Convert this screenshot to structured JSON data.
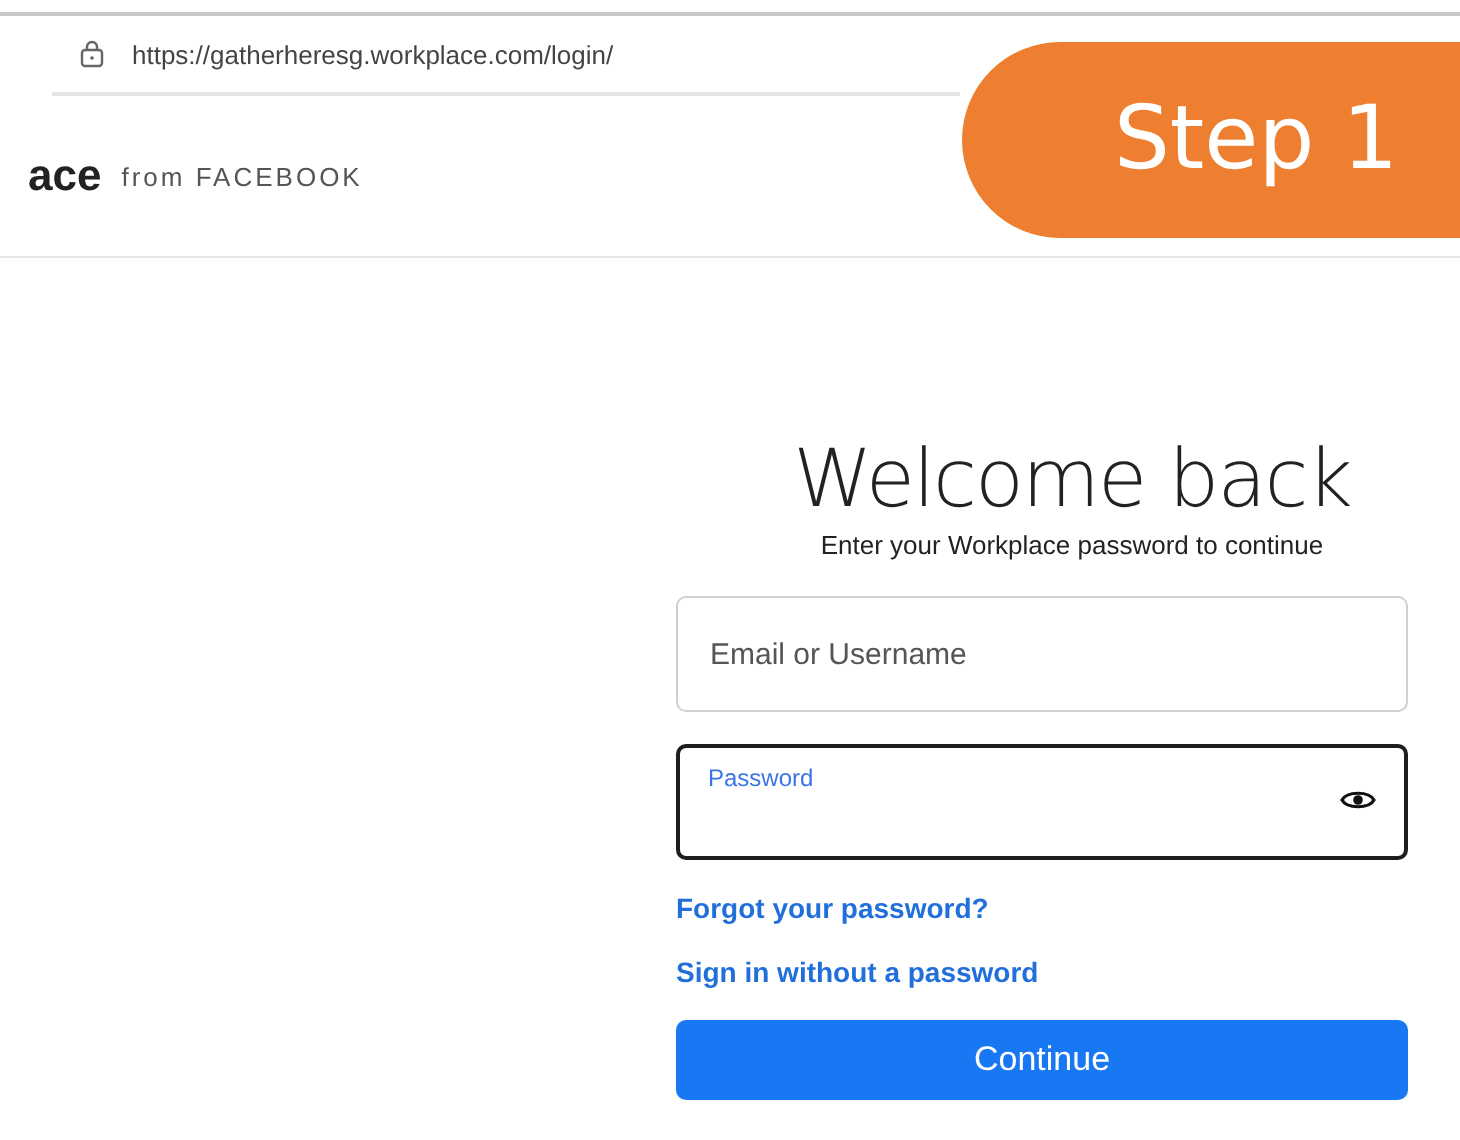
{
  "address_bar": {
    "url": "https://gatherheresg.workplace.com/login/"
  },
  "header": {
    "logo": "ace",
    "tagline": "from FACEBOOK"
  },
  "step_badge": {
    "text": "Step 1"
  },
  "login": {
    "title": "Welcome back",
    "subtitle": "Enter your Workplace password to continue",
    "fields": [
      {
        "kind": "text",
        "placeholder": "Email or Username",
        "focused": false
      },
      {
        "kind": "password",
        "label": "Password",
        "focused": true
      }
    ],
    "links": [
      "Forgot your password?",
      "Sign in without a password"
    ],
    "button": "Continue"
  }
}
